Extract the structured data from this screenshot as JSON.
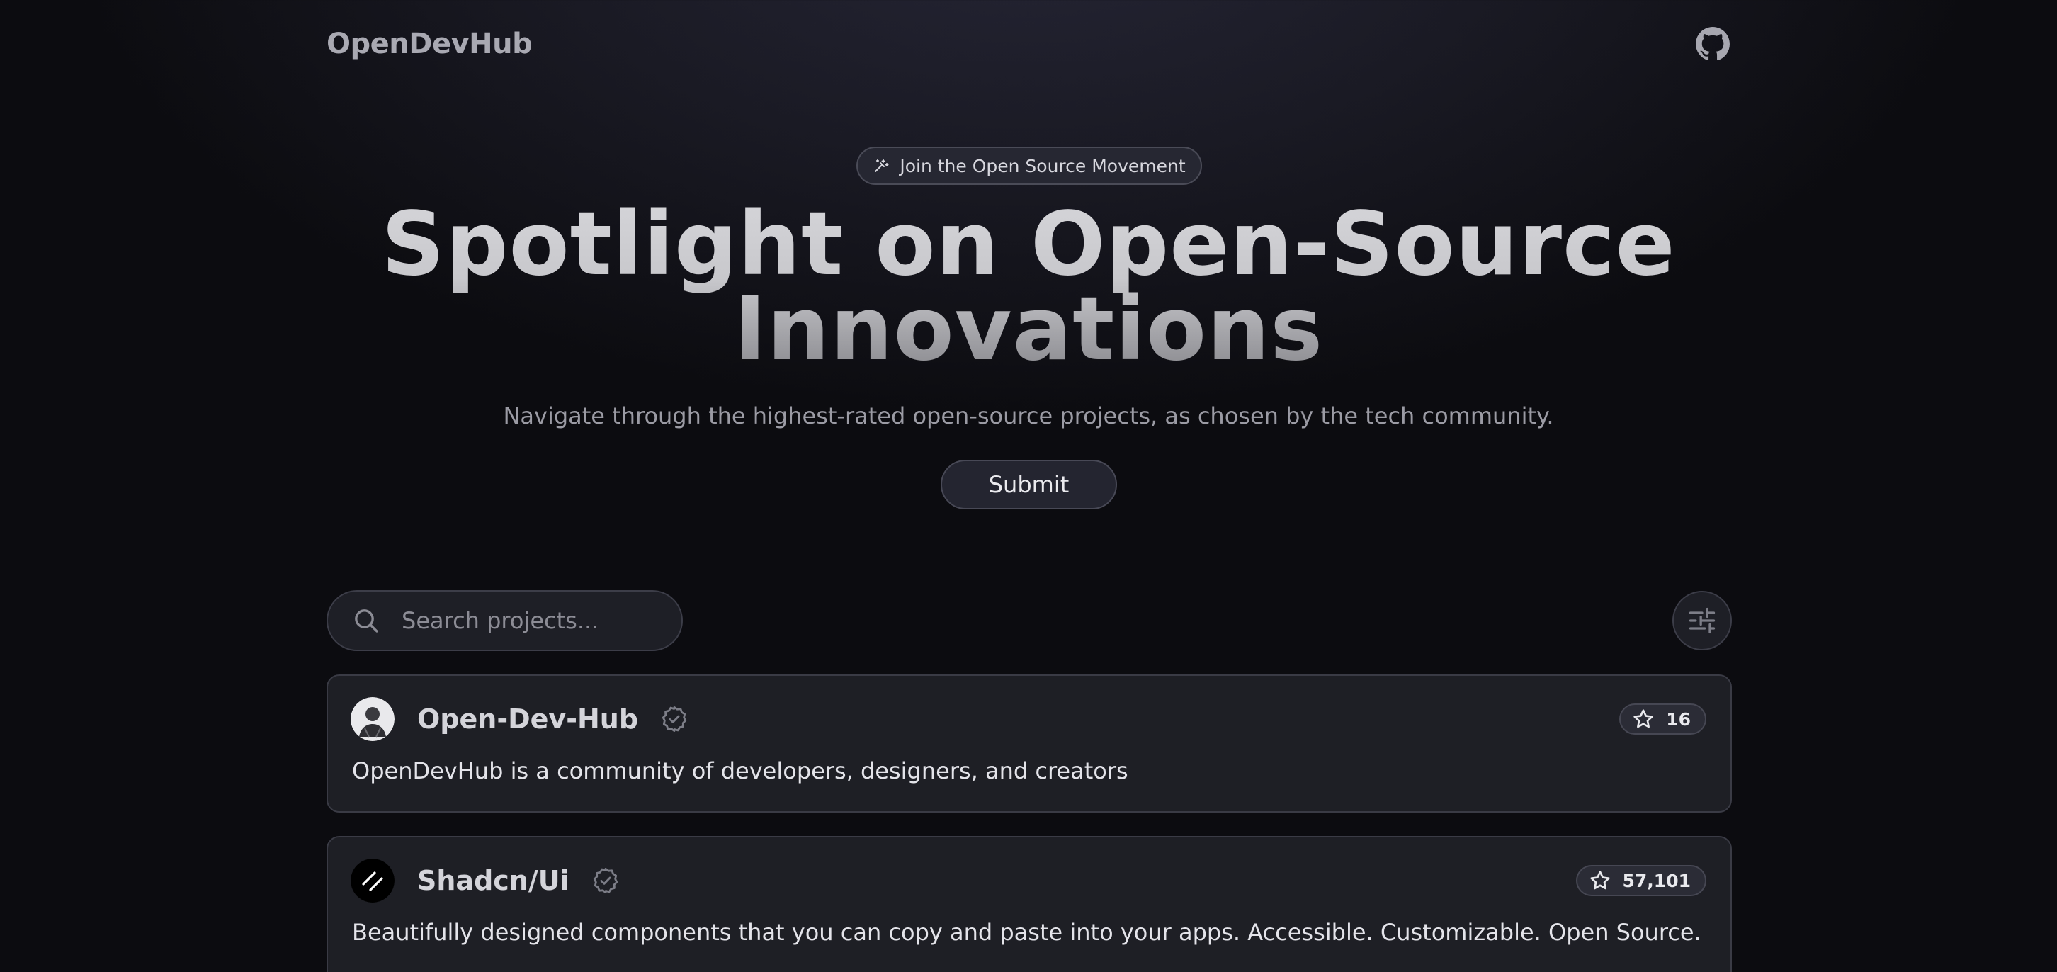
{
  "header": {
    "logo": "OpenDevHub",
    "github_icon": "github-icon"
  },
  "hero": {
    "badge": {
      "icon": "sparkles-icon",
      "label": "Join the Open Source Movement"
    },
    "title_line1": "Spotlight on Open-Source",
    "title_line2": "Innovations",
    "subtitle": "Navigate through the highest-rated open-source projects, as chosen by the tech community.",
    "submit_label": "Submit"
  },
  "search": {
    "placeholder": "Search projects...",
    "value": "",
    "icon": "search-icon"
  },
  "filter": {
    "icon": "sliders-icon"
  },
  "projects": [
    {
      "name": "Open-Dev-Hub",
      "verified": true,
      "stars": "16",
      "description": "OpenDevHub is a community of developers, designers, and creators"
    },
    {
      "name": "Shadcn/Ui",
      "verified": true,
      "stars": "57,101",
      "description": "Beautifully designed components that you can copy and paste into your apps. Accessible. Customizable. Open Source."
    }
  ],
  "colors": {
    "background": "#0b0b0e",
    "card_bg": "#1e1f25",
    "border": "#3a3b45",
    "text_muted": "#9b9ba4"
  }
}
